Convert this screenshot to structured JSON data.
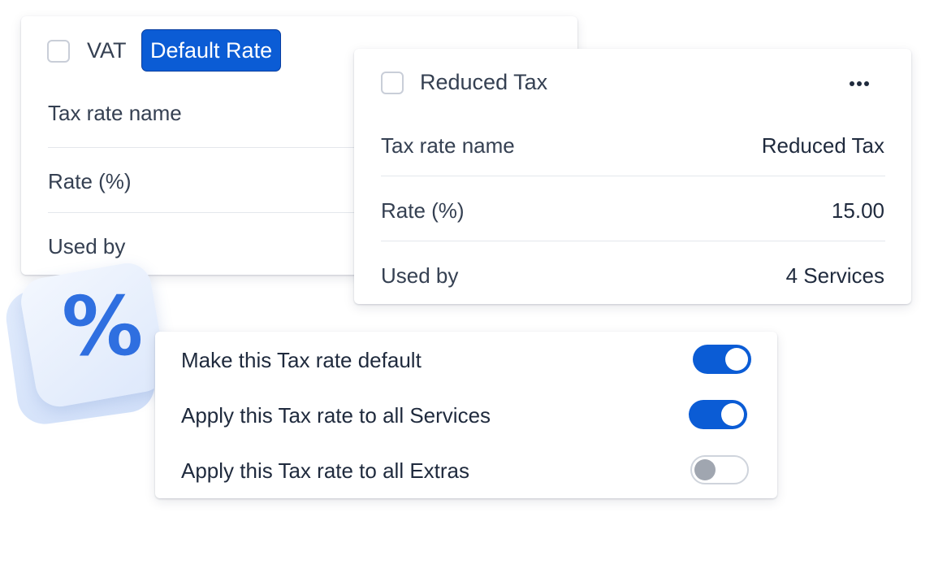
{
  "vat_card": {
    "title": "VAT",
    "badge": "Default Rate",
    "rows": [
      {
        "label": "Tax rate name"
      },
      {
        "label": "Rate (%)"
      },
      {
        "label": "Used by"
      }
    ]
  },
  "reduced_card": {
    "title": "Reduced Tax",
    "more_icon": "more-horizontal-icon",
    "rows": [
      {
        "label": "Tax rate name",
        "value": "Reduced Tax"
      },
      {
        "label": "Rate (%)",
        "value": "15.00"
      },
      {
        "label": "Used by",
        "value": "4 Services"
      }
    ]
  },
  "percent_icon": {
    "glyph": "%",
    "icon": "percent-icon"
  },
  "toggles": [
    {
      "label": "Make this Tax rate default",
      "on": true
    },
    {
      "label": "Apply this Tax rate to all Services",
      "on": true
    },
    {
      "label": "Apply this Tax rate to all Extras",
      "on": false
    }
  ],
  "colors": {
    "accent": "#0b5cd5",
    "text": "#354052",
    "toggle_off_knob": "#a0a6b0"
  }
}
